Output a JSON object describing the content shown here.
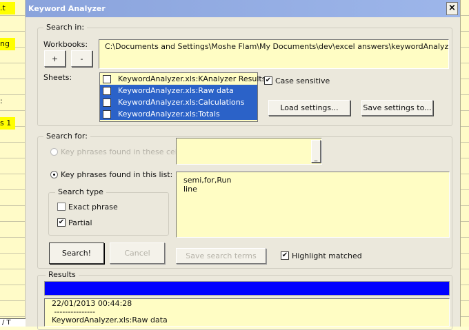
{
  "spreadsheet": {
    "cells": [
      "t.",
      "ng",
      ":",
      "s 1"
    ],
    "sheet_tab": "/ T"
  },
  "window": {
    "title": "Keyword Analyzer",
    "close": "×"
  },
  "search_in": {
    "legend": "Search in:",
    "workbooks_label": "Workbooks:",
    "add_label": "+",
    "remove_label": "-",
    "workbook_path": "C:\\Documents and Settings\\Moshe Flam\\My Documents\\dev\\excel answers\\keywordAnalyzer\\Keyword.",
    "sheets_label": "Sheets:",
    "sheets": [
      {
        "name": "KeywordAnalyzer.xls:KAnalyzer Results",
        "checked": false,
        "selected": false
      },
      {
        "name": "KeywordAnalyzer.xls:Raw data",
        "checked": true,
        "selected": true
      },
      {
        "name": "KeywordAnalyzer.xls:Calculations",
        "checked": true,
        "selected": true
      },
      {
        "name": "KeywordAnalyzer.xls:Totals",
        "checked": true,
        "selected": true
      }
    ],
    "case_sensitive_label": "Case sensitive",
    "case_sensitive": true,
    "load_settings": "Load settings...",
    "save_settings": "Save settings to..."
  },
  "search_for": {
    "legend": "Search for:",
    "option_cells": "Key phrases found in these cells:",
    "browse": "_",
    "option_list": "Key phrases found in this list:",
    "phrases": "semi,for,Run\nline",
    "search_type_legend": "Search type",
    "exact_phrase": "Exact phrase",
    "exact_checked": false,
    "partial": "Partial",
    "partial_checked": true,
    "search_btn": "Search!",
    "cancel_btn": "Cancel",
    "save_terms_btn": "Save search terms",
    "highlight_label": "Highlight matched",
    "highlight_checked": true
  },
  "results": {
    "legend": "Results",
    "progress": 1.0,
    "progress_color": "#0000ff",
    "lines": [
      "22/01/2013 00:44:28",
      " ---------------",
      "KeywordAnalyzer.xls:Raw data"
    ]
  }
}
